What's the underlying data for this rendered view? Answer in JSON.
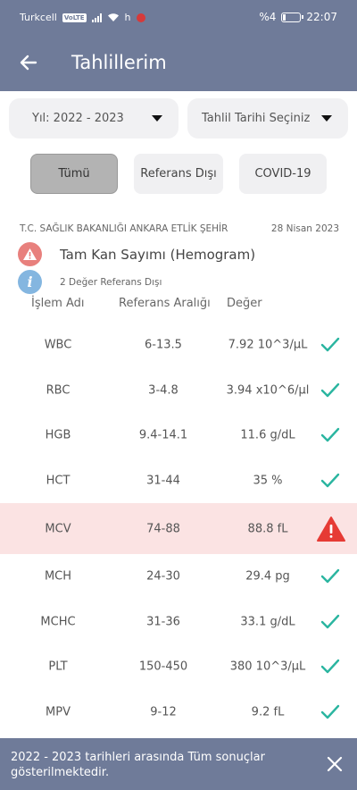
{
  "status_bar": {
    "carrier": "Turkcell",
    "volte": "VoLTE",
    "h_indicator": "h",
    "battery_percent": "%4",
    "time": "22:07",
    "icons": [
      "signal-icon",
      "wifi-icon",
      "notification-icon",
      "battery-icon"
    ]
  },
  "header": {
    "title": "Tahlillerim",
    "back_icon": "arrow-left-icon"
  },
  "filters": {
    "year": "Yıl: 2022 - 2023",
    "date": "Tahlil Tarihi Seçiniz"
  },
  "tabs": [
    {
      "label": "Tümü",
      "active": true
    },
    {
      "label": "Referans Dışı",
      "active": false
    },
    {
      "label": "COVID-19",
      "active": false
    }
  ],
  "result": {
    "source": "T.C. SAĞLIK BAKANLIĞI ANKARA ETLİK ŞEHİR",
    "date": "28 Nisan 2023",
    "test_name": "Tam Kan Sayımı (Hemogram)",
    "info": "2 Değer Referans Dışı"
  },
  "columns": {
    "name": "İşlem Adı",
    "range": "Referans Aralığı",
    "value": "Değer"
  },
  "rows": [
    {
      "name": "WBC",
      "range": "6-13.5",
      "value": "7.92 10^3/µL",
      "status": "ok"
    },
    {
      "name": "RBC",
      "range": "3-4.8",
      "value": "3.94 x10^6/µl",
      "status": "ok"
    },
    {
      "name": "HGB",
      "range": "9.4-14.1",
      "value": "11.6 g/dL",
      "status": "ok"
    },
    {
      "name": "HCT",
      "range": "31-44",
      "value": "35 %",
      "status": "ok"
    },
    {
      "name": "MCV",
      "range": "74-88",
      "value": "88.8 fL",
      "status": "warning"
    },
    {
      "name": "MCH",
      "range": "24-30",
      "value": "29.4 pg",
      "status": "ok"
    },
    {
      "name": "MCHC",
      "range": "31-36",
      "value": "33.1 g/dL",
      "status": "ok"
    },
    {
      "name": "PLT",
      "range": "150-450",
      "value": "380 10^3/µL",
      "status": "ok"
    },
    {
      "name": "MPV",
      "range": "9-12",
      "value": "9.2 fL",
      "status": "ok"
    }
  ],
  "snackbar": {
    "message": "2022 - 2023 tarihleri arasında Tüm sonuçlar gösterilmektedir."
  },
  "colors": {
    "header": "#6f7b99",
    "ok": "#2ab5a0",
    "warning": "#e63b35",
    "flag_bg": "#fbe3e3"
  }
}
